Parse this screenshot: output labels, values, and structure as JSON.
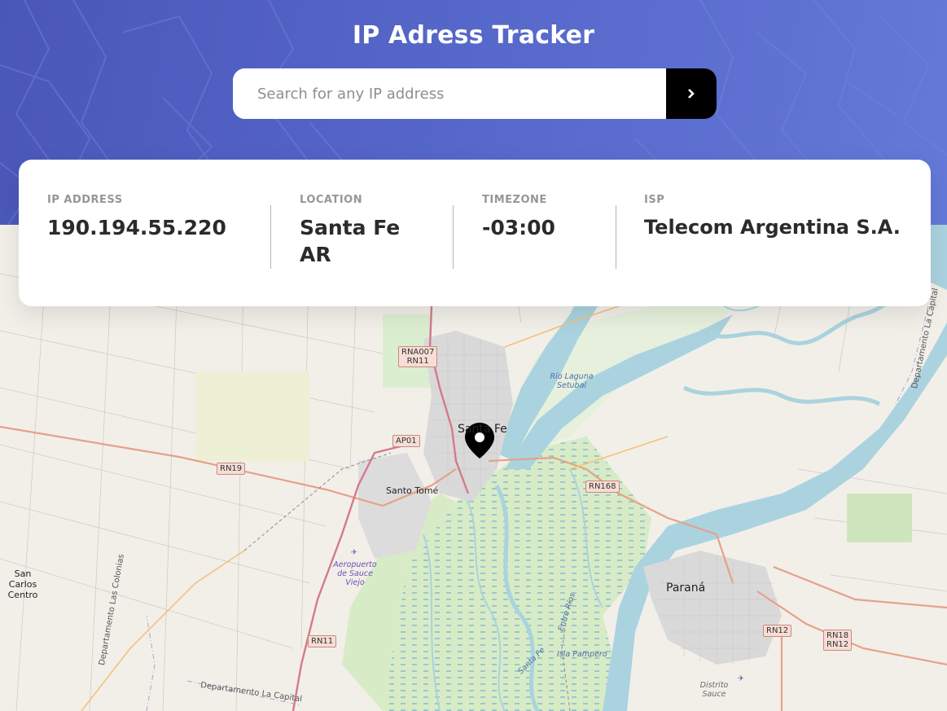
{
  "app": {
    "title": "IP Adress Tracker"
  },
  "search": {
    "placeholder": "Search for any IP address",
    "value": ""
  },
  "info": {
    "ip": {
      "label": "IP ADDRESS",
      "value": "190.194.55.220"
    },
    "location": {
      "label": "LOCATION",
      "value_line1": "Santa Fe",
      "value_line2": "AR"
    },
    "timezone": {
      "label": "TIMEZONE",
      "value": "-03:00"
    },
    "isp": {
      "label": "ISP",
      "value": "Telecom Argentina S.A."
    }
  },
  "map": {
    "cities": {
      "santa_fe": "Santa Fe",
      "santo_tome": "Santo Tomé",
      "parana": "Paraná",
      "san_carlos_1": "San Carlos",
      "san_carlos_2": "Centro"
    },
    "roads": {
      "rna007": "RNA007",
      "rn11_top": "RN11",
      "ap01": "AP01",
      "rn19": "RN19",
      "rn168": "RN168",
      "rn11_bottom": "RN11",
      "rn12": "RN12",
      "rn18": "RN18",
      "rn12_b": "RN12"
    },
    "water": {
      "laguna_1": "Río Laguna",
      "laguna_2": "Setubal",
      "isla": "Isla Pampero",
      "entre_rios": "Entre Ríos",
      "santa_fe_river": "Santa Fe"
    },
    "places": {
      "airport_1": "Aeropuerto",
      "airport_2": "de Sauce",
      "airport_3": "Viejo",
      "distrito_1": "Distrito",
      "distrito_2": "Sauce"
    },
    "admin": {
      "las_colonias": "Departamento Las Colonias",
      "la_capital": "Departamento La Capital",
      "la_capital_right": "Departamento La Capital"
    }
  },
  "colors": {
    "hero_start": "#4a57b8",
    "hero_end": "#6479d8",
    "button": "#000000",
    "text_dark": "#2b2b2b",
    "text_label": "#969696",
    "water": "#aad3df",
    "wetland": "#d8eed0",
    "urban": "#dcdcdc"
  },
  "icons": {
    "submit": "chevron-right-icon",
    "marker": "location-pin-icon"
  }
}
